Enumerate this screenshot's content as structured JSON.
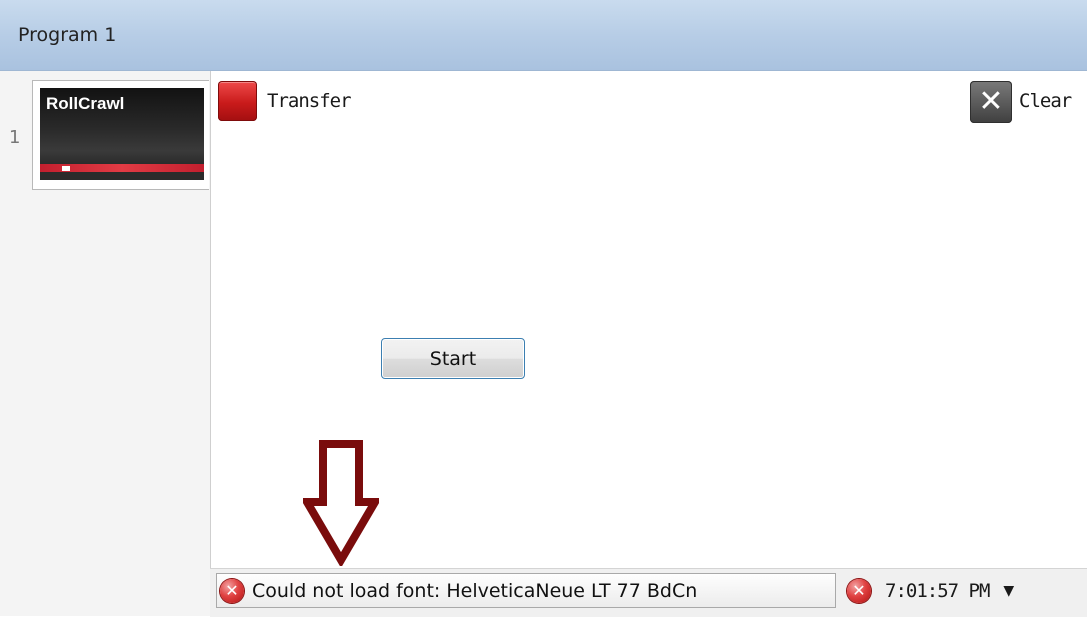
{
  "window": {
    "title": "Program 1"
  },
  "playlist": {
    "row_number": "1",
    "items": [
      {
        "thumbnail_label": "RollCrawl"
      }
    ]
  },
  "toolbar": {
    "transfer_label": "Transfer",
    "clear_label": "Clear"
  },
  "main": {
    "start_label": "Start"
  },
  "status": {
    "error_message": "Could not load font: HelveticaNeue LT 77 BdCn",
    "time": "7:01:57 PM"
  },
  "icons": {
    "transfer": "red-square-icon",
    "clear": "clear-x-icon",
    "error": "error-circle-icon",
    "dropdown": "chevron-down-icon",
    "annotation": "down-arrow-icon"
  },
  "colors": {
    "titlebar": "#b7cde6",
    "transfer_red": "#c91b1b",
    "button_border": "#3c7fb1",
    "annotation_arrow": "#7a0c0c",
    "error_red": "#e04141"
  }
}
